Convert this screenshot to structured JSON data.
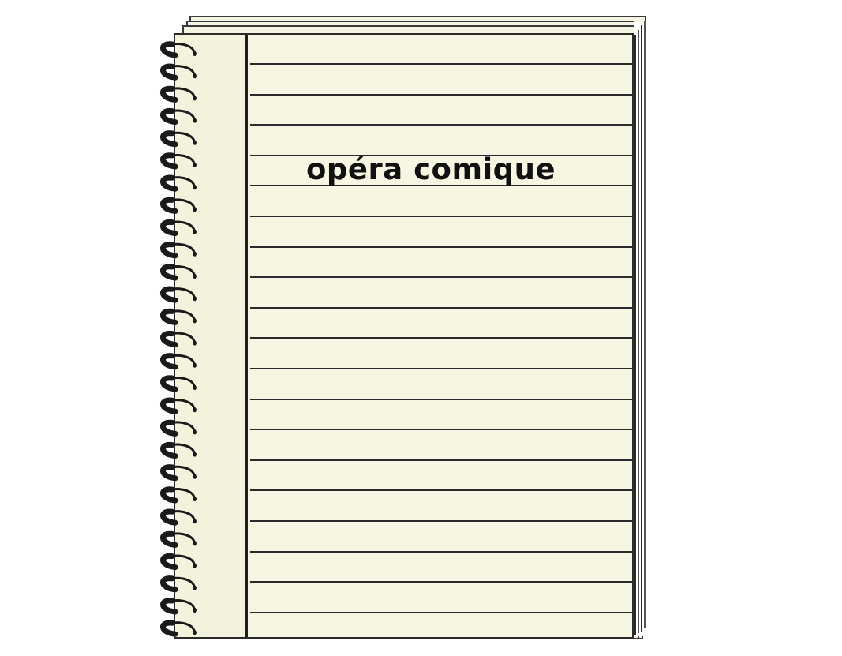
{
  "notebook": {
    "title": "opéra comique",
    "paper_color": "#f6f6e2",
    "line_color": "#2a2a2a",
    "spiral_color": "#1a1a1a",
    "ruled_line_count": 20,
    "spiral_ring_count": 27,
    "spiral-icon": "spiral-binding-icon"
  }
}
